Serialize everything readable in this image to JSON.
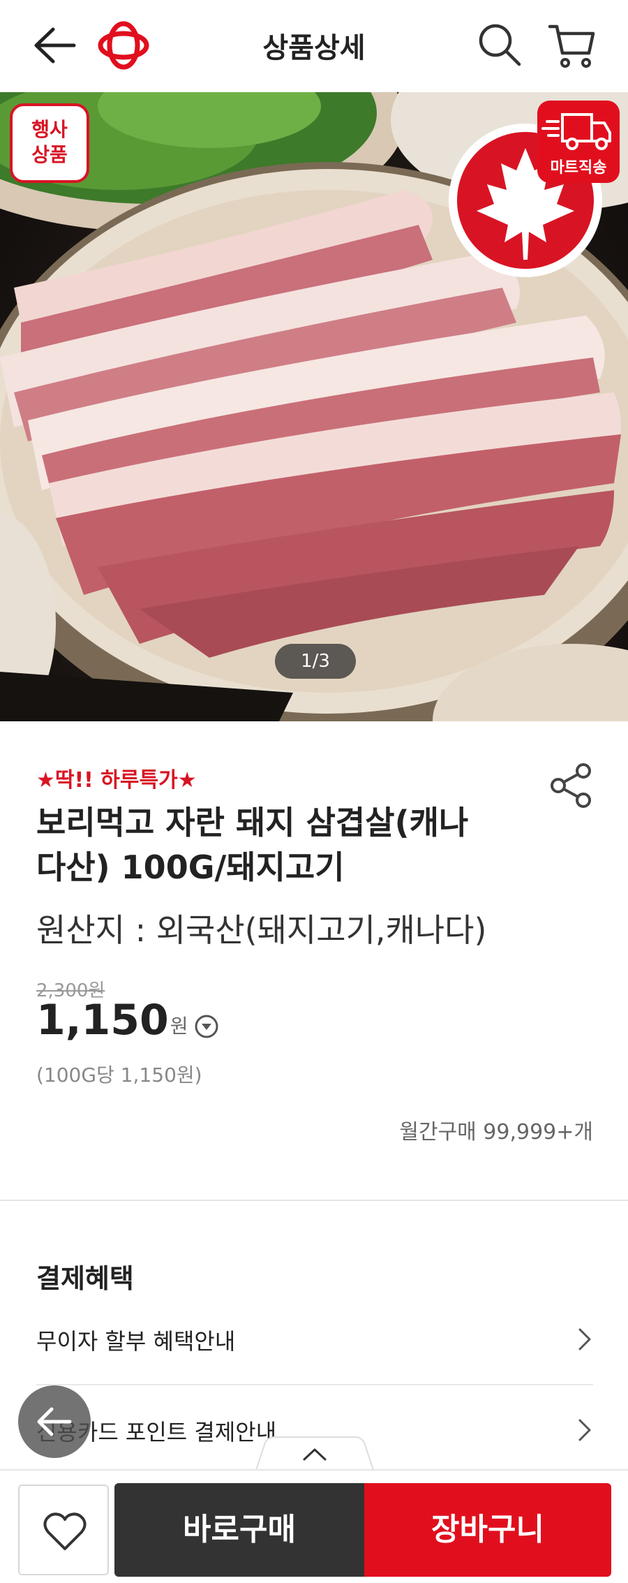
{
  "header": {
    "title": "상품상세",
    "back_icon": "arrow-left-icon",
    "logo_icon": "brand-logo-icon",
    "search_icon": "search-icon",
    "cart_icon": "cart-icon"
  },
  "hero": {
    "event_badge": "행사\n상품",
    "event_badge_line1": "행사",
    "event_badge_line2": "상품",
    "origin_badge_icon": "canada-maple-leaf-icon",
    "delivery_badge_label": "마트직송",
    "delivery_icon": "delivery-truck-icon",
    "pager": "1/3"
  },
  "product": {
    "promo": "★딱!! 하루특가★",
    "name_line1": "보리먹고 자란 돼지 삼겹살(캐나",
    "name_line2": "다산) 100G/돼지고기",
    "origin": "원산지 : 외국산(돼지고기,캐나다)",
    "original_price": "2,300원",
    "price": "1,150",
    "currency": "원",
    "unit_price": "(100G당 1,150원)",
    "monthly_purchases": "월간구매 99,999+개"
  },
  "benefits": {
    "title": "결제혜택",
    "items": [
      {
        "label": "무이자 할부 혜택안내"
      },
      {
        "label": "신용카드 포인트 결제안내"
      }
    ]
  },
  "bottom_bar": {
    "wish_icon": "heart-icon",
    "buy_now": "바로구매",
    "add_to_cart": "장바구니"
  },
  "colors": {
    "brand_red": "#e10f1e",
    "dark_button": "#333333"
  }
}
